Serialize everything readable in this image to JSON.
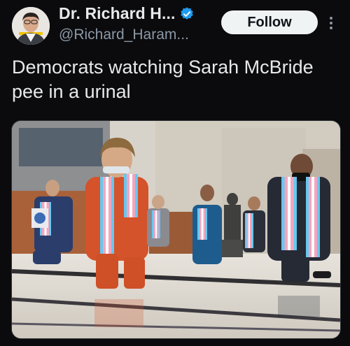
{
  "author": {
    "display_name": "Dr. Richard H...",
    "handle": "@Richard_Haram...",
    "avatar_icon": "person-avatar-icon",
    "verified_icon": "verified-badge-icon",
    "verified_color": "#1d9bf0"
  },
  "actions": {
    "follow_label": "Follow",
    "more_icon": "more-vertical-icon"
  },
  "tweet": {
    "text": "Democrats watching Sarah McBride pee in a urinal"
  },
  "media": {
    "kind": "photo"
  },
  "colors": {
    "background": "#0b0b0d",
    "text": "#e7e9ea",
    "muted": "#8b98a5",
    "follow_bg": "#eff3f4"
  }
}
